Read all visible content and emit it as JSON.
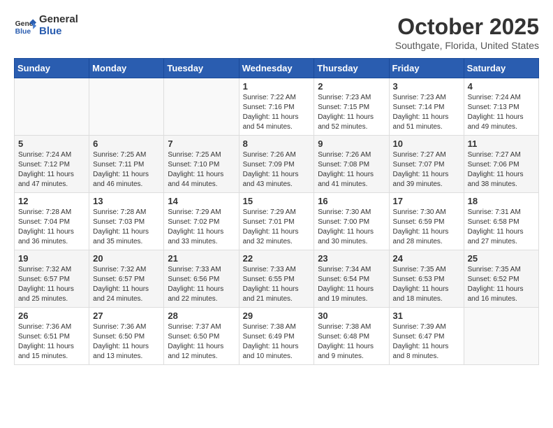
{
  "header": {
    "logo_line1": "General",
    "logo_line2": "Blue",
    "month_title": "October 2025",
    "subtitle": "Southgate, Florida, United States"
  },
  "days_of_week": [
    "Sunday",
    "Monday",
    "Tuesday",
    "Wednesday",
    "Thursday",
    "Friday",
    "Saturday"
  ],
  "weeks": [
    [
      {
        "day": "",
        "info": ""
      },
      {
        "day": "",
        "info": ""
      },
      {
        "day": "",
        "info": ""
      },
      {
        "day": "1",
        "info": "Sunrise: 7:22 AM\nSunset: 7:16 PM\nDaylight: 11 hours and 54 minutes."
      },
      {
        "day": "2",
        "info": "Sunrise: 7:23 AM\nSunset: 7:15 PM\nDaylight: 11 hours and 52 minutes."
      },
      {
        "day": "3",
        "info": "Sunrise: 7:23 AM\nSunset: 7:14 PM\nDaylight: 11 hours and 51 minutes."
      },
      {
        "day": "4",
        "info": "Sunrise: 7:24 AM\nSunset: 7:13 PM\nDaylight: 11 hours and 49 minutes."
      }
    ],
    [
      {
        "day": "5",
        "info": "Sunrise: 7:24 AM\nSunset: 7:12 PM\nDaylight: 11 hours and 47 minutes."
      },
      {
        "day": "6",
        "info": "Sunrise: 7:25 AM\nSunset: 7:11 PM\nDaylight: 11 hours and 46 minutes."
      },
      {
        "day": "7",
        "info": "Sunrise: 7:25 AM\nSunset: 7:10 PM\nDaylight: 11 hours and 44 minutes."
      },
      {
        "day": "8",
        "info": "Sunrise: 7:26 AM\nSunset: 7:09 PM\nDaylight: 11 hours and 43 minutes."
      },
      {
        "day": "9",
        "info": "Sunrise: 7:26 AM\nSunset: 7:08 PM\nDaylight: 11 hours and 41 minutes."
      },
      {
        "day": "10",
        "info": "Sunrise: 7:27 AM\nSunset: 7:07 PM\nDaylight: 11 hours and 39 minutes."
      },
      {
        "day": "11",
        "info": "Sunrise: 7:27 AM\nSunset: 7:06 PM\nDaylight: 11 hours and 38 minutes."
      }
    ],
    [
      {
        "day": "12",
        "info": "Sunrise: 7:28 AM\nSunset: 7:04 PM\nDaylight: 11 hours and 36 minutes."
      },
      {
        "day": "13",
        "info": "Sunrise: 7:28 AM\nSunset: 7:03 PM\nDaylight: 11 hours and 35 minutes."
      },
      {
        "day": "14",
        "info": "Sunrise: 7:29 AM\nSunset: 7:02 PM\nDaylight: 11 hours and 33 minutes."
      },
      {
        "day": "15",
        "info": "Sunrise: 7:29 AM\nSunset: 7:01 PM\nDaylight: 11 hours and 32 minutes."
      },
      {
        "day": "16",
        "info": "Sunrise: 7:30 AM\nSunset: 7:00 PM\nDaylight: 11 hours and 30 minutes."
      },
      {
        "day": "17",
        "info": "Sunrise: 7:30 AM\nSunset: 6:59 PM\nDaylight: 11 hours and 28 minutes."
      },
      {
        "day": "18",
        "info": "Sunrise: 7:31 AM\nSunset: 6:58 PM\nDaylight: 11 hours and 27 minutes."
      }
    ],
    [
      {
        "day": "19",
        "info": "Sunrise: 7:32 AM\nSunset: 6:57 PM\nDaylight: 11 hours and 25 minutes."
      },
      {
        "day": "20",
        "info": "Sunrise: 7:32 AM\nSunset: 6:57 PM\nDaylight: 11 hours and 24 minutes."
      },
      {
        "day": "21",
        "info": "Sunrise: 7:33 AM\nSunset: 6:56 PM\nDaylight: 11 hours and 22 minutes."
      },
      {
        "day": "22",
        "info": "Sunrise: 7:33 AM\nSunset: 6:55 PM\nDaylight: 11 hours and 21 minutes."
      },
      {
        "day": "23",
        "info": "Sunrise: 7:34 AM\nSunset: 6:54 PM\nDaylight: 11 hours and 19 minutes."
      },
      {
        "day": "24",
        "info": "Sunrise: 7:35 AM\nSunset: 6:53 PM\nDaylight: 11 hours and 18 minutes."
      },
      {
        "day": "25",
        "info": "Sunrise: 7:35 AM\nSunset: 6:52 PM\nDaylight: 11 hours and 16 minutes."
      }
    ],
    [
      {
        "day": "26",
        "info": "Sunrise: 7:36 AM\nSunset: 6:51 PM\nDaylight: 11 hours and 15 minutes."
      },
      {
        "day": "27",
        "info": "Sunrise: 7:36 AM\nSunset: 6:50 PM\nDaylight: 11 hours and 13 minutes."
      },
      {
        "day": "28",
        "info": "Sunrise: 7:37 AM\nSunset: 6:50 PM\nDaylight: 11 hours and 12 minutes."
      },
      {
        "day": "29",
        "info": "Sunrise: 7:38 AM\nSunset: 6:49 PM\nDaylight: 11 hours and 10 minutes."
      },
      {
        "day": "30",
        "info": "Sunrise: 7:38 AM\nSunset: 6:48 PM\nDaylight: 11 hours and 9 minutes."
      },
      {
        "day": "31",
        "info": "Sunrise: 7:39 AM\nSunset: 6:47 PM\nDaylight: 11 hours and 8 minutes."
      },
      {
        "day": "",
        "info": ""
      }
    ]
  ]
}
